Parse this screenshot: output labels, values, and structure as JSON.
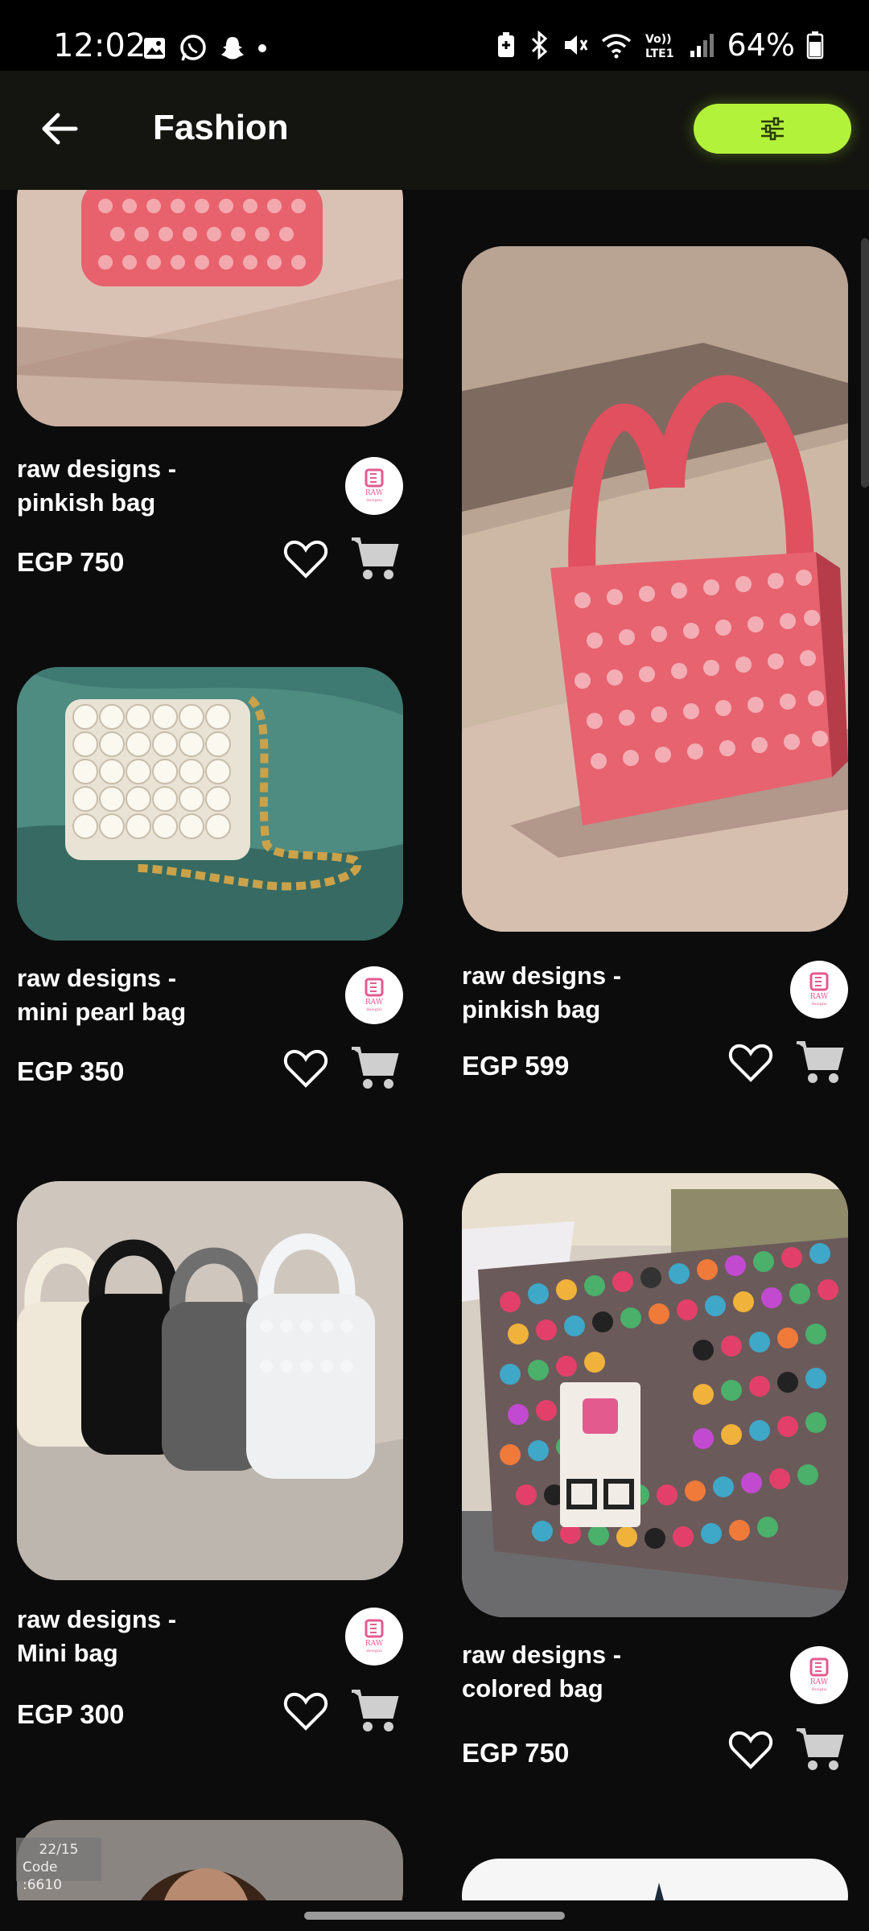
{
  "status_bar": {
    "time": "12:02",
    "battery": "64%",
    "left_icons": [
      "gallery-icon",
      "whatsapp-icon",
      "snapchat-icon",
      "dot-icon"
    ],
    "right_icons": [
      "battery-saver-icon",
      "bluetooth-icon",
      "mute-icon",
      "wifi-icon",
      "volte-icon",
      "signal-icon",
      "battery-icon"
    ]
  },
  "app_bar": {
    "title": "Fashion",
    "filter_button_color": "#b3f23a"
  },
  "products": [
    {
      "title": "raw designs  -\npinkish bag",
      "price": "EGP 750",
      "image": "pink-bead-bag-cropped"
    },
    {
      "title": "raw designs  -\npinkish bag",
      "price": "EGP 599",
      "image": "pink-bead-bag"
    },
    {
      "title": "raw designs  -\nmini pearl bag",
      "price": "EGP 350",
      "image": "pearl-bag"
    },
    {
      "title": "raw designs  -\ncolored bag",
      "price": "EGP 750",
      "image": "colored-bead-bag"
    },
    {
      "title": "raw designs  -\nMini bag",
      "price": "EGP 300",
      "image": "four-mini-bags"
    }
  ],
  "overlay_badge": {
    "line1": "22/15",
    "line2": "Code :6610"
  },
  "colors": {
    "background": "#0c0c0c",
    "app_bar": "#141510",
    "accent": "#b3f23a"
  }
}
